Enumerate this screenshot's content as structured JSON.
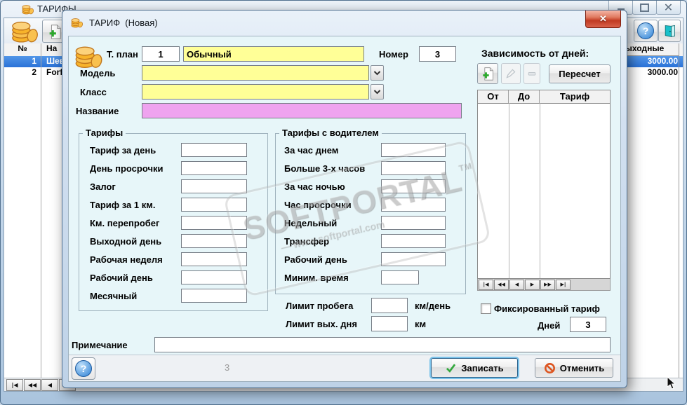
{
  "icons": {
    "close": "✕",
    "help": "?"
  },
  "colors": {
    "selection": "#2f7de0",
    "field_yellow": "#ffff97",
    "field_pink": "#efa3ef",
    "close_red": "#c13a22"
  },
  "watermark": {
    "line1": "SOFTPORTAL",
    "tm": "TM",
    "line2": "— www.softportal.com"
  },
  "background_window": {
    "title": "ТАРИФЫ",
    "table": {
      "headers": {
        "num": "№",
        "name": "На",
        "weekend": "Выходные"
      },
      "rows": [
        {
          "num": "1",
          "name": "Шев",
          "weekend": "3000.00"
        },
        {
          "num": "2",
          "name": "Forf",
          "weekend": "3000.00"
        }
      ]
    },
    "navigator": [
      "|◀",
      "◀◀",
      "◀",
      "▶"
    ]
  },
  "dialog": {
    "title": "ТАРИФ  (Новая)",
    "plan_label": "Т. план",
    "plan_value": "1",
    "plan_name": "Обычный",
    "number_label": "Номер",
    "number_value": "3",
    "model_label": "Модель",
    "class_label": "Класс",
    "name_label": "Название",
    "tariffs": {
      "title": "Тарифы",
      "items": [
        "Тариф за день",
        "День просрочки",
        "Залог",
        "Тариф за 1 км.",
        "Км. перепробег",
        "Выходной день",
        "Рабочая неделя",
        "Рабочий день",
        "Месячный"
      ]
    },
    "driver_tariffs": {
      "title": "Тарифы с водителем",
      "items": [
        "За час днем",
        "Больше 3-х часов",
        "За час ночью",
        "Час просрочки",
        "Недельный",
        "Трансфер",
        "Рабочий день",
        "Миним. время"
      ]
    },
    "limits": {
      "mileage_label": "Лимит пробега",
      "mileage_unit": "км/день",
      "weekend_label": "Лимит вых. дня",
      "weekend_unit": "км"
    },
    "days_panel": {
      "title": "Зависимость от дней:",
      "recalc": "Пересчет",
      "columns": [
        "От",
        "До",
        "Тариф"
      ],
      "navigator": [
        "|◀",
        "◀◀",
        "◀",
        "▶",
        "▶▶",
        "▶|"
      ],
      "fixed_label": "Фиксированный тариф",
      "days_label": "Дней",
      "days_value": "3"
    },
    "note_label": "Примечание",
    "footer": {
      "counter": "3",
      "save": "Записать",
      "cancel": "Отменить"
    }
  }
}
